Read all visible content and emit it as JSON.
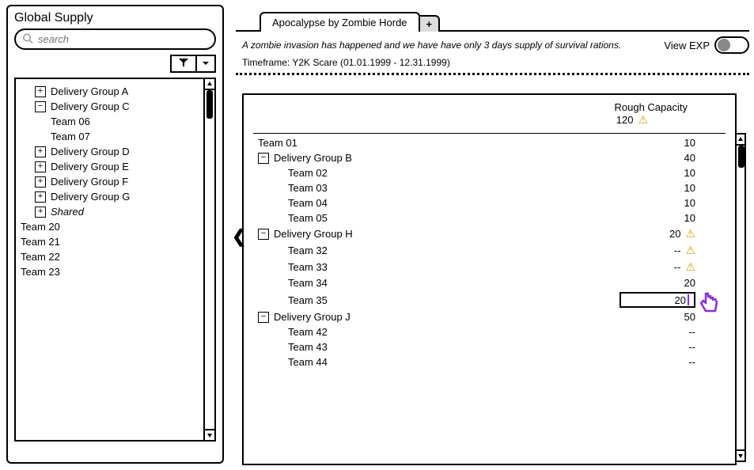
{
  "sidebar": {
    "title": "Global Supply",
    "search_placeholder": "search",
    "tree": [
      {
        "kind": "group",
        "exp": "collapsed",
        "label": "Delivery Group A"
      },
      {
        "kind": "group",
        "exp": "expanded",
        "label": "Delivery Group C"
      },
      {
        "kind": "team",
        "indent": 2,
        "label": "Team 06"
      },
      {
        "kind": "team",
        "indent": 2,
        "label": "Team 07"
      },
      {
        "kind": "group",
        "exp": "collapsed",
        "label": "Delivery Group D"
      },
      {
        "kind": "group",
        "exp": "collapsed",
        "label": "Delivery Group E"
      },
      {
        "kind": "group",
        "exp": "collapsed",
        "label": "Delivery Group F"
      },
      {
        "kind": "group",
        "exp": "collapsed",
        "label": "Delivery Group G"
      },
      {
        "kind": "group",
        "exp": "collapsed",
        "label": "Shared",
        "italic": true
      }
    ],
    "flat": [
      "Team 20",
      "Team 21",
      "Team 22",
      "Team 23"
    ]
  },
  "tabs": {
    "active": "Apocalypse by Zombie Horde"
  },
  "header": {
    "description": "A zombie invasion has happened and we have have only 3 days supply of survival rations.",
    "timeframe_label": "Timeframe: Y2K Scare (01.01.1999 - 12.31.1999)",
    "view_exp_label": "View EXP",
    "view_exp_on": false
  },
  "table": {
    "header_label": "Rough Capacity",
    "total": "120",
    "total_warn": true,
    "rows": [
      {
        "indent": "a",
        "exp": null,
        "label": "Team 01",
        "value": "10",
        "warn": false
      },
      {
        "indent": "a",
        "exp": "expanded",
        "label": "Delivery Group B",
        "value": "40",
        "warn": false
      },
      {
        "indent": "c",
        "exp": null,
        "label": "Team 02",
        "value": "10",
        "warn": false
      },
      {
        "indent": "c",
        "exp": null,
        "label": "Team 03",
        "value": "10",
        "warn": false
      },
      {
        "indent": "c",
        "exp": null,
        "label": "Team 04",
        "value": "10",
        "warn": false
      },
      {
        "indent": "c",
        "exp": null,
        "label": "Team 05",
        "value": "10",
        "warn": false
      },
      {
        "indent": "a",
        "exp": "expanded",
        "label": "Delivery Group H",
        "value": "20",
        "warn": true
      },
      {
        "indent": "c",
        "exp": null,
        "label": "Team 32",
        "value": "--",
        "warn": true
      },
      {
        "indent": "c",
        "exp": null,
        "label": "Team 33",
        "value": "--",
        "warn": true
      },
      {
        "indent": "c",
        "exp": null,
        "label": "Team 34",
        "value": "20",
        "warn": false
      },
      {
        "indent": "c",
        "exp": null,
        "label": "Team 35",
        "value": "20",
        "warn": false,
        "editing": true
      },
      {
        "indent": "a",
        "exp": "expanded",
        "label": "Delivery Group J",
        "value": "50",
        "warn": false
      },
      {
        "indent": "c",
        "exp": null,
        "label": "Team 42",
        "value": "--",
        "warn": false
      },
      {
        "indent": "c",
        "exp": null,
        "label": "Team 43",
        "value": "--",
        "warn": false
      },
      {
        "indent": "c",
        "exp": null,
        "label": "Team 44",
        "value": "--",
        "warn": false
      }
    ]
  }
}
